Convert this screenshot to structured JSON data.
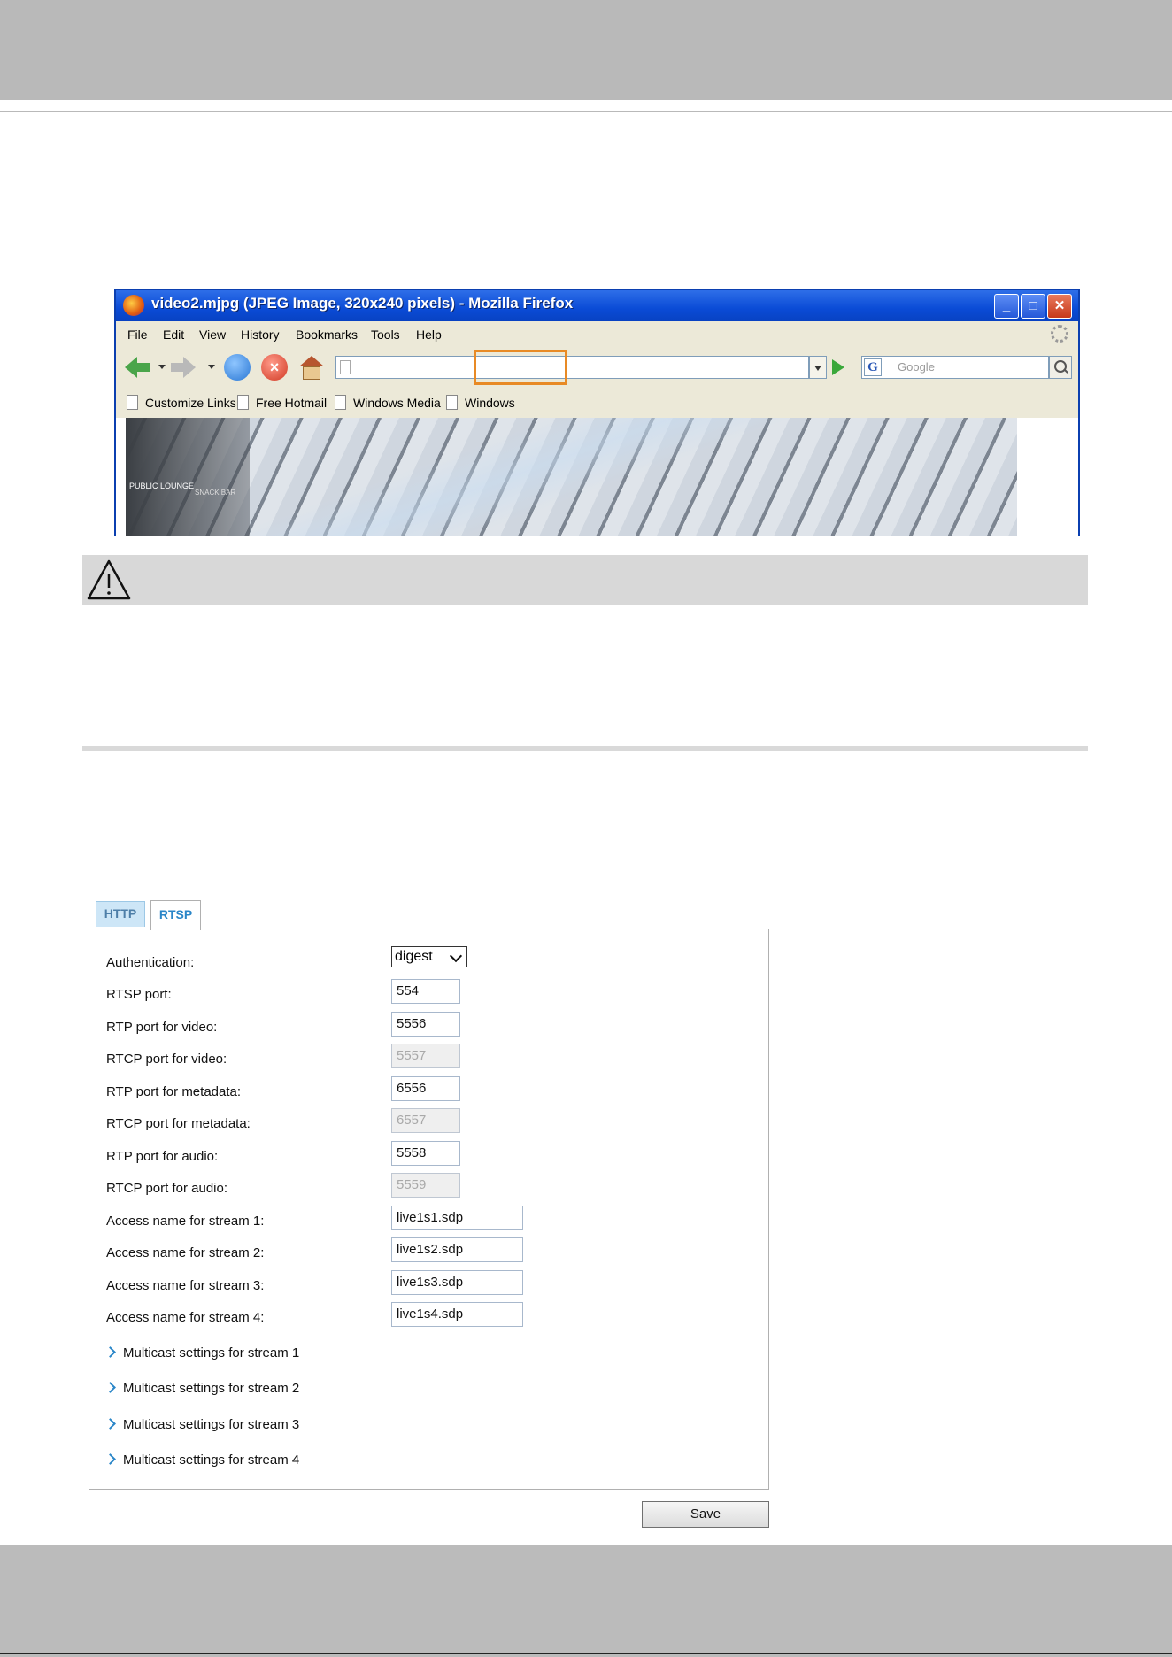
{
  "browser": {
    "title": "video2.mjpg (JPEG Image, 320x240 pixels) - Mozilla Firefox",
    "window_buttons": {
      "minimize": "_",
      "maximize": "□",
      "close": "✕"
    },
    "menu": [
      "File",
      "Edit",
      "View",
      "History",
      "Bookmarks",
      "Tools",
      "Help"
    ],
    "search_placeholder": "Google",
    "search_engine_letter": "G",
    "bookmarks": [
      "Customize Links",
      "Free Hotmail",
      "Windows Media",
      "Windows"
    ],
    "image_signs": {
      "lounge": "PUBLIC LOUNGE",
      "snack": "SNACK BAR"
    },
    "icons": [
      "firefox-logo-icon",
      "back-icon",
      "forward-icon",
      "reload-icon",
      "stop-icon",
      "home-icon",
      "go-icon",
      "search-icon",
      "throbber-icon"
    ]
  },
  "tabs": {
    "http": "HTTP",
    "rtsp": "RTSP"
  },
  "rtsp": {
    "authentication": {
      "label": "Authentication:",
      "value": "digest",
      "options": [
        "digest"
      ]
    },
    "fields": [
      {
        "label": "RTSP port:",
        "value": "554",
        "disabled": false
      },
      {
        "label": "RTP port for video:",
        "value": "5556",
        "disabled": false
      },
      {
        "label": "RTCP port for video:",
        "value": "5557",
        "disabled": true
      },
      {
        "label": "RTP port for metadata:",
        "value": "6556",
        "disabled": false
      },
      {
        "label": "RTCP port for metadata:",
        "value": "6557",
        "disabled": true
      },
      {
        "label": "RTP port for audio:",
        "value": "5558",
        "disabled": false
      },
      {
        "label": "RTCP port for audio:",
        "value": "5559",
        "disabled": true
      },
      {
        "label": "Access name for stream 1:",
        "value": "live1s1.sdp",
        "disabled": false
      },
      {
        "label": "Access name for stream 2:",
        "value": "live1s2.sdp",
        "disabled": false
      },
      {
        "label": "Access name for stream 3:",
        "value": "live1s3.sdp",
        "disabled": false
      },
      {
        "label": "Access name for stream 4:",
        "value": "live1s4.sdp",
        "disabled": false
      }
    ],
    "multicast": [
      "Multicast settings for stream 1",
      "Multicast settings for stream 2",
      "Multicast settings for stream 3",
      "Multicast settings for stream 4"
    ],
    "save_label": "Save"
  },
  "colors": {
    "page_band": "#b9b9b9",
    "accent_blue": "#2a86c8",
    "url_highlight": "#e88a25",
    "warning_bar": "#d8d8d8"
  },
  "icons": {
    "warning": "warning-triangle-icon",
    "expand": "chevron-right-icon"
  }
}
